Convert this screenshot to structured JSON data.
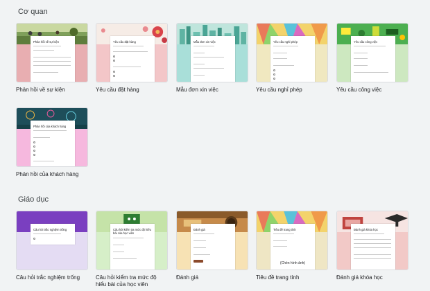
{
  "sections": {
    "first": "Cơ quan",
    "second": "Giáo dục"
  },
  "templates": {
    "event_feedback": {
      "label": "Phản hồi về sự kiện",
      "form_title": "Phản hồi về sự kiện"
    },
    "order_request": {
      "label": "Yêu cầu đặt hàng",
      "form_title": "Yêu cầu đặt hàng"
    },
    "job_application": {
      "label": "Mẫu đơn xin việc",
      "form_title": "Mẫu đơn xin việc"
    },
    "time_off": {
      "label": "Yêu cầu nghỉ phép",
      "form_title": "Yêu cầu nghỉ phép"
    },
    "work_request": {
      "label": "Yêu cầu công việc",
      "form_title": "Yêu cầu công việc"
    },
    "customer_feedback": {
      "label": "Phản hồi của khách hàng",
      "form_title": "Phản hồi của khách hàng"
    },
    "blank_quiz": {
      "label": "Câu hỏi trắc nghiệm trống",
      "form_title": "Câu hỏi trắc nghiệm trống"
    },
    "assessment": {
      "label": "Câu hỏi kiểm tra mức độ hiểu bài của học viên",
      "form_title": "Câu hỏi kiểm tra mức độ hiểu bài của học viên"
    },
    "evaluation": {
      "label": "Đánh giá",
      "form_title": "Đánh giá"
    },
    "worksheet": {
      "label": "Tiêu đề trang tính",
      "form_title": "Tiêu đề trang tính",
      "center_text": "(Chèn hình ảnh)"
    },
    "course_eval": {
      "label": "Đánh giá khóa học",
      "form_title": "Đánh giá khóa học"
    }
  },
  "colors": {
    "background": "#f1f3f4",
    "pink": "#e8aeb1",
    "light_pink": "#f3c6c8",
    "mint": "#a9dfd9",
    "cream": "#f0e8c0",
    "light_green": "#cde8c0",
    "bright_pink": "#f6b8de",
    "lavender": "#e4dcf3",
    "purple": "#7a3fc0",
    "light_green2": "#d6efc8",
    "peach": "#f7e2b4",
    "cream2": "#efe6c4",
    "pink2": "#f2c9c7"
  }
}
